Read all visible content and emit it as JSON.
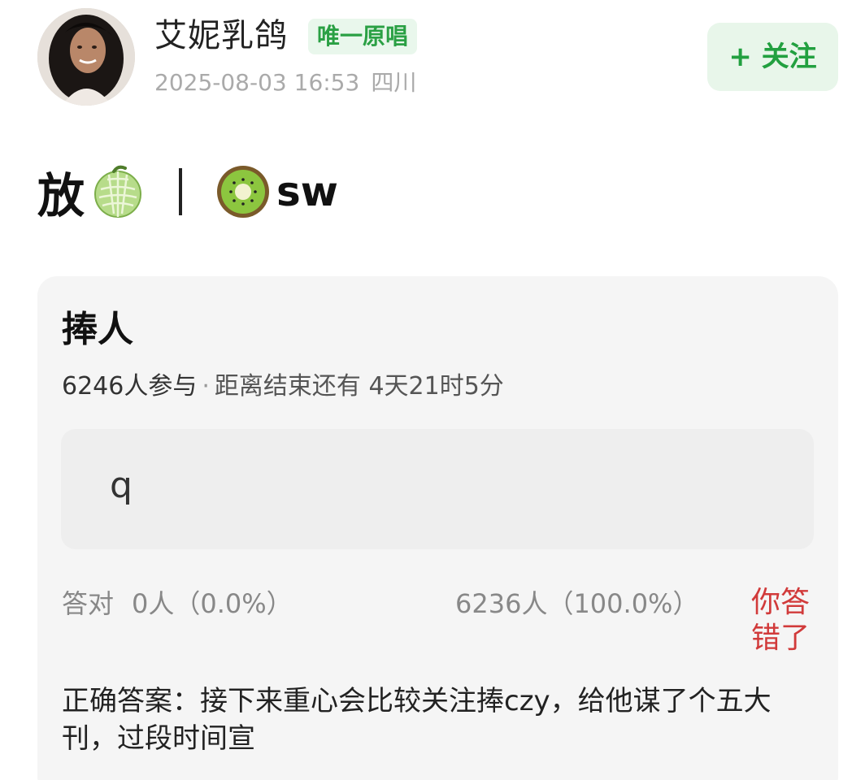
{
  "header": {
    "username": "艾妮乳鸽",
    "badge": "唯一原唱",
    "timestamp": "2025-08-03 16:53",
    "location": "四川",
    "follow_label": "+ 关注"
  },
  "post": {
    "text_part1": "放",
    "emoji1": "melon",
    "separator": "|",
    "emoji2": "kiwi",
    "text_part2": "sw"
  },
  "quiz": {
    "title": "捧人",
    "participants": "6246人参与",
    "separator": "·",
    "remaining": "距离结束还有 4天21时5分",
    "option": "q",
    "correct_label": "答对",
    "correct_stat": "0人（0.0%）",
    "wrong_stat": "6236人（100.0%）",
    "wrong_label": "你答错了",
    "answer": "正确答案：接下来重心会比较关注捧czy，给他谋了个五大刊，过段时间宣"
  },
  "colors": {
    "accent_green": "#22a040",
    "badge_bg": "#e9f7ec",
    "error_red": "#d13a3a"
  }
}
